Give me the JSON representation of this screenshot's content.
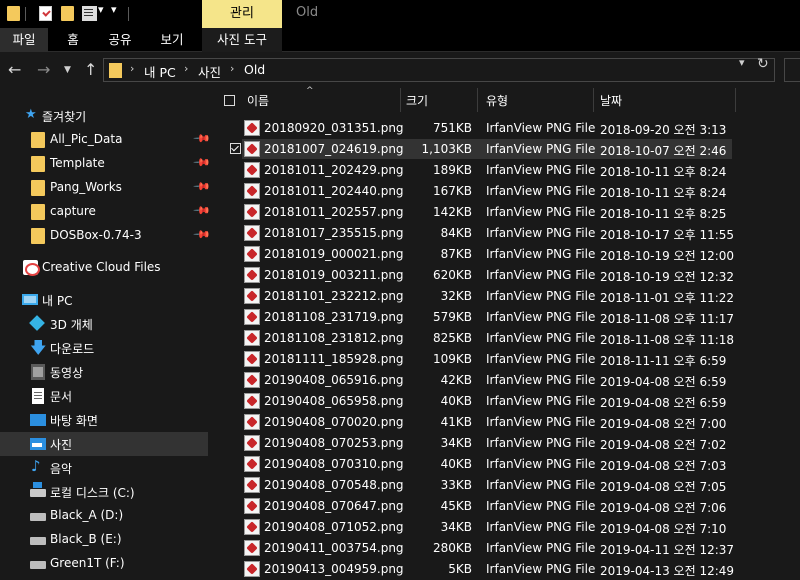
{
  "window": {
    "context_tab": "관리",
    "title": "Old"
  },
  "ribbon": {
    "tabs": [
      "파일",
      "홈",
      "공유",
      "보기",
      "사진 도구"
    ]
  },
  "address": {
    "crumbs": [
      "내 PC",
      "사진",
      "Old"
    ]
  },
  "sidebar": {
    "quick_access": "즐겨찾기",
    "pinned": [
      "All_Pic_Data",
      "Template",
      "Pang_Works",
      "capture",
      "DOSBox-0.74-3"
    ],
    "creative_cloud": "Creative Cloud Files",
    "this_pc": "내 PC",
    "pc_items": [
      "3D 개체",
      "다운로드",
      "동영상",
      "문서",
      "바탕 화면",
      "사진",
      "음악",
      "로컬 디스크 (C:)",
      "Black_A (D:)",
      "Black_B (E:)",
      "Green1T (F:)"
    ]
  },
  "columns": {
    "name": "이름",
    "size": "크기",
    "type": "유형",
    "date": "날짜"
  },
  "files": [
    {
      "name": "20180920_031351.png",
      "size": "751KB",
      "type": "IrfanView PNG File",
      "date": "2018-09-20 오전 3:13"
    },
    {
      "name": "20181007_024619.png",
      "size": "1,103KB",
      "type": "IrfanView PNG File",
      "date": "2018-10-07 오전 2:46"
    },
    {
      "name": "20181011_202429.png",
      "size": "189KB",
      "type": "IrfanView PNG File",
      "date": "2018-10-11 오후 8:24"
    },
    {
      "name": "20181011_202440.png",
      "size": "167KB",
      "type": "IrfanView PNG File",
      "date": "2018-10-11 오후 8:24"
    },
    {
      "name": "20181011_202557.png",
      "size": "142KB",
      "type": "IrfanView PNG File",
      "date": "2018-10-11 오후 8:25"
    },
    {
      "name": "20181017_235515.png",
      "size": "84KB",
      "type": "IrfanView PNG File",
      "date": "2018-10-17 오후 11:55"
    },
    {
      "name": "20181019_000021.png",
      "size": "87KB",
      "type": "IrfanView PNG File",
      "date": "2018-10-19 오전 12:00"
    },
    {
      "name": "20181019_003211.png",
      "size": "620KB",
      "type": "IrfanView PNG File",
      "date": "2018-10-19 오전 12:32"
    },
    {
      "name": "20181101_232212.png",
      "size": "32KB",
      "type": "IrfanView PNG File",
      "date": "2018-11-01 오후 11:22"
    },
    {
      "name": "20181108_231719.png",
      "size": "579KB",
      "type": "IrfanView PNG File",
      "date": "2018-11-08 오후 11:17"
    },
    {
      "name": "20181108_231812.png",
      "size": "825KB",
      "type": "IrfanView PNG File",
      "date": "2018-11-08 오후 11:18"
    },
    {
      "name": "20181111_185928.png",
      "size": "109KB",
      "type": "IrfanView PNG File",
      "date": "2018-11-11 오후 6:59"
    },
    {
      "name": "20190408_065916.png",
      "size": "42KB",
      "type": "IrfanView PNG File",
      "date": "2019-04-08 오전 6:59"
    },
    {
      "name": "20190408_065958.png",
      "size": "40KB",
      "type": "IrfanView PNG File",
      "date": "2019-04-08 오전 6:59"
    },
    {
      "name": "20190408_070020.png",
      "size": "41KB",
      "type": "IrfanView PNG File",
      "date": "2019-04-08 오전 7:00"
    },
    {
      "name": "20190408_070253.png",
      "size": "34KB",
      "type": "IrfanView PNG File",
      "date": "2019-04-08 오전 7:02"
    },
    {
      "name": "20190408_070310.png",
      "size": "40KB",
      "type": "IrfanView PNG File",
      "date": "2019-04-08 오전 7:03"
    },
    {
      "name": "20190408_070548.png",
      "size": "33KB",
      "type": "IrfanView PNG File",
      "date": "2019-04-08 오전 7:05"
    },
    {
      "name": "20190408_070647.png",
      "size": "45KB",
      "type": "IrfanView PNG File",
      "date": "2019-04-08 오전 7:06"
    },
    {
      "name": "20190408_071052.png",
      "size": "34KB",
      "type": "IrfanView PNG File",
      "date": "2019-04-08 오전 7:10"
    },
    {
      "name": "20190411_003754.png",
      "size": "280KB",
      "type": "IrfanView PNG File",
      "date": "2019-04-11 오전 12:37"
    },
    {
      "name": "20190413_004959.png",
      "size": "5KB",
      "type": "IrfanView PNG File",
      "date": "2019-04-13 오전 12:49"
    }
  ]
}
